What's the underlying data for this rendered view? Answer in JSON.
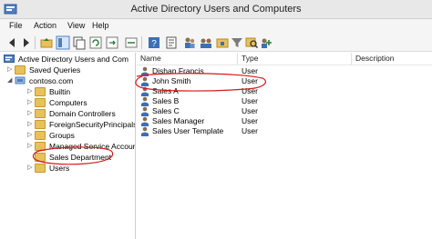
{
  "window": {
    "title": "Active Directory Users and Computers"
  },
  "menu": [
    "File",
    "Action",
    "View",
    "Help"
  ],
  "toolbar": {
    "buttons": [
      "back-icon",
      "forward-icon",
      "folder-up-icon",
      "console-tree-icon",
      "copy-icon",
      "refresh-icon",
      "export-icon",
      "help-icon",
      "properties-icon",
      "new-user-icon",
      "new-group-icon",
      "new-ou-icon",
      "filter-icon",
      "find-icon",
      "add-to-group-icon"
    ]
  },
  "tree": {
    "root": "Active Directory Users and Com",
    "items": [
      {
        "label": "Saved Queries"
      },
      {
        "label": "contoso.com"
      },
      {
        "label": "Builtin"
      },
      {
        "label": "Computers"
      },
      {
        "label": "Domain Controllers"
      },
      {
        "label": "ForeignSecurityPrincipals"
      },
      {
        "label": "Groups"
      },
      {
        "label": "Managed Service Accour"
      },
      {
        "label": "Sales Department"
      },
      {
        "label": "Users"
      }
    ]
  },
  "list": {
    "columns": [
      "Name",
      "Type",
      "Description"
    ],
    "rows": [
      {
        "name": "Dishan Francis",
        "type": "User"
      },
      {
        "name": "John Smith",
        "type": "User"
      },
      {
        "name": "Sales A",
        "type": "User"
      },
      {
        "name": "Sales B",
        "type": "User"
      },
      {
        "name": "Sales C",
        "type": "User"
      },
      {
        "name": "Sales Manager",
        "type": "User"
      },
      {
        "name": "Sales User Template",
        "type": "User"
      }
    ]
  },
  "colors": {
    "annotation": "#d41a1a",
    "folder": "#e8c15c"
  }
}
